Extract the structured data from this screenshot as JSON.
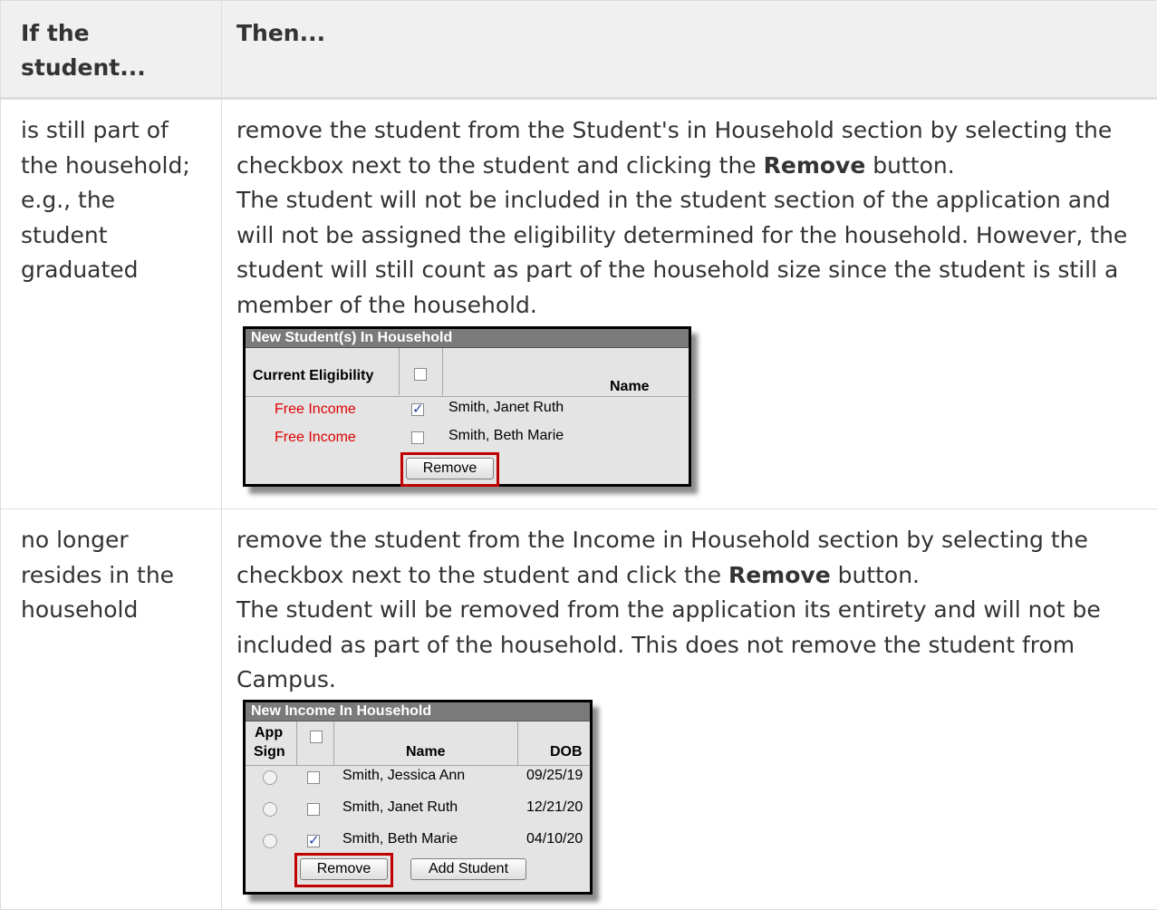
{
  "table": {
    "headers": [
      "If the student...",
      "Then..."
    ],
    "rows": [
      {
        "condition": "is still part of the household; e.g., the student graduated",
        "action_pre": "remove the student from the Student's in Household section by selecting the checkbox next to the student and clicking the ",
        "action_bold": "Remove",
        "action_post": " button.",
        "note": "The student will not be included in the student section of the application and will not be assigned the eligibility determined for the household. However, the student will still count as part of the household size since the student is still a member of the household."
      },
      {
        "condition": "no longer resides in the household",
        "action_pre": "remove the student from the Income in Household section by selecting the checkbox next to the student and click the ",
        "action_bold": "Remove",
        "action_post": " button.",
        "note": "The student will be removed from the application its entirety and will not be included as part of the household. This does not remove the student from Campus."
      }
    ]
  },
  "screenshot1": {
    "title": "New Student(s) In Household",
    "col_eligibility": "Current Eligibility",
    "col_name": "Name",
    "rows": [
      {
        "eligibility": "Free Income",
        "name": "Smith, Janet Ruth",
        "checked": true
      },
      {
        "eligibility": "Free Income",
        "name": "Smith, Beth Marie",
        "checked": false
      }
    ],
    "remove_label": "Remove"
  },
  "screenshot2": {
    "title": "New Income In Household",
    "col_app": "App",
    "col_sign": "Sign",
    "col_name": "Name",
    "col_dob": "DOB",
    "rows": [
      {
        "name": "Smith, Jessica Ann",
        "dob": "09/25/19",
        "checked": false
      },
      {
        "name": "Smith, Janet Ruth",
        "dob": "12/21/20",
        "checked": false
      },
      {
        "name": "Smith, Beth Marie",
        "dob": "04/10/20",
        "checked": true
      }
    ],
    "remove_label": "Remove",
    "add_label": "Add Student"
  }
}
